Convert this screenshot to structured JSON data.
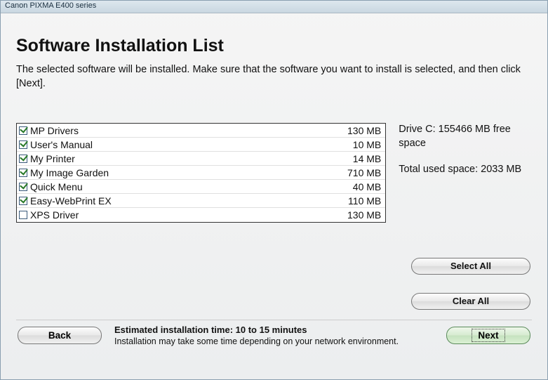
{
  "window": {
    "title": "Canon PIXMA E400 series"
  },
  "page": {
    "title": "Software Installation List",
    "instruction": "The selected software will be installed. Make sure that the software you want to install is selected, and then click [Next]."
  },
  "list": [
    {
      "checked": true,
      "label": "MP Drivers",
      "size": "130 MB"
    },
    {
      "checked": true,
      "label": "User's Manual",
      "size": "10 MB"
    },
    {
      "checked": true,
      "label": "My Printer",
      "size": "14 MB"
    },
    {
      "checked": true,
      "label": "My Image Garden",
      "size": "710 MB"
    },
    {
      "checked": true,
      "label": "Quick Menu",
      "size": "40 MB"
    },
    {
      "checked": true,
      "label": "Easy-WebPrint EX",
      "size": "110 MB"
    },
    {
      "checked": false,
      "label": "XPS Driver",
      "size": "130 MB"
    }
  ],
  "side": {
    "free_space": "Drive C: 155466 MB free space",
    "used_space": "Total used space: 2033 MB"
  },
  "buttons": {
    "select_all": "Select All",
    "clear_all": "Clear All",
    "back": "Back",
    "next": "Next"
  },
  "footer": {
    "est_title": "Estimated installation time: 10 to 15 minutes",
    "est_note": "Installation may take some time depending on your network environment."
  }
}
